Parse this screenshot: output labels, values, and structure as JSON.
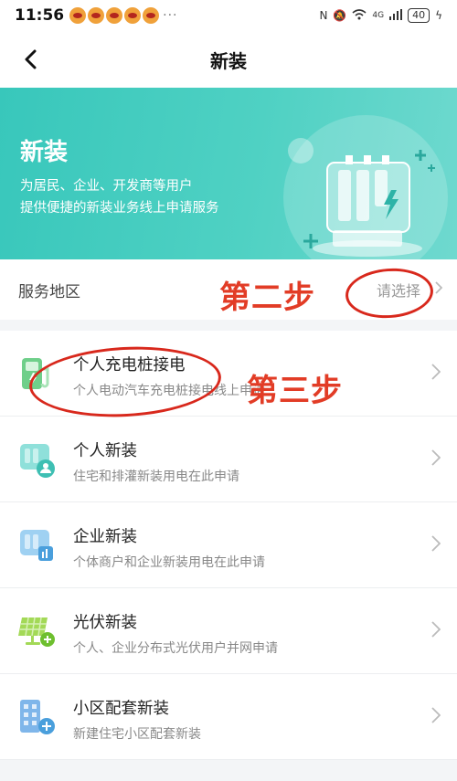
{
  "status_bar": {
    "time": "11:56",
    "more": "···",
    "network": "4G",
    "battery": "40"
  },
  "nav": {
    "title": "新装"
  },
  "banner": {
    "title": "新装",
    "desc_line1": "为居民、企业、开发商等用户",
    "desc_line2": "提供便捷的新装业务线上申请服务"
  },
  "region": {
    "label": "服务地区",
    "placeholder": "请选择"
  },
  "items": [
    {
      "title": "个人充电桩接电",
      "desc": "个人电动汽车充电桩接电线上申请"
    },
    {
      "title": "个人新装",
      "desc": "住宅和排灌新装用电在此申请"
    },
    {
      "title": "企业新装",
      "desc": "个体商户和企业新装用电在此申请"
    },
    {
      "title": "光伏新装",
      "desc": "个人、企业分布式光伏用户并网申请"
    },
    {
      "title": "小区配套新装",
      "desc": "新建住宅小区配套新装"
    }
  ],
  "annotations": {
    "step2": "第二步",
    "step3": "第三步"
  },
  "colors": {
    "banner": "#4fd1c3",
    "annotation": "#e23c26",
    "accent": "#38c7bb"
  }
}
